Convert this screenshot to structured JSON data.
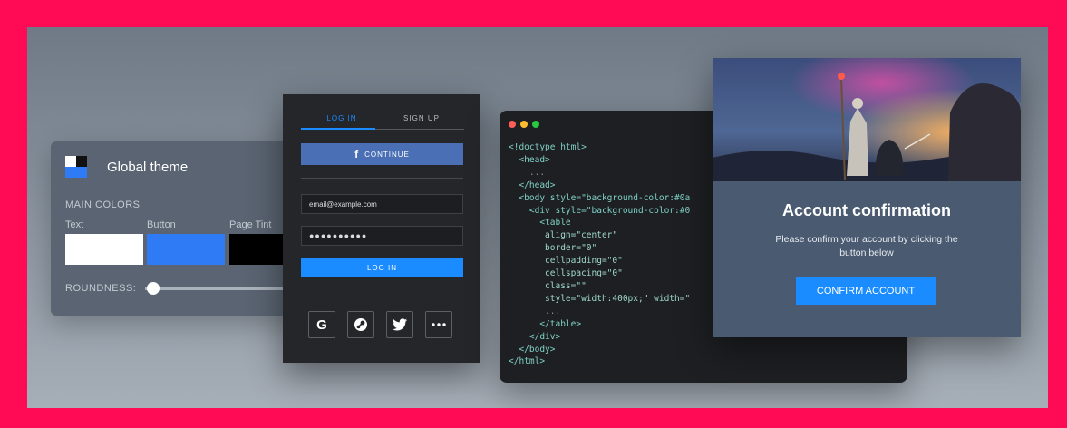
{
  "theme_panel": {
    "title": "Global theme",
    "main_colors_label": "MAIN COLORS",
    "swatches": [
      {
        "label": "Text",
        "color": "#ffffff"
      },
      {
        "label": "Button",
        "color": "#2f7bf5"
      },
      {
        "label": "Page Tint",
        "color": "#000000"
      }
    ],
    "roundness_label": "ROUNDNESS:",
    "logo_icon": "theme-logo-icon"
  },
  "login_panel": {
    "tab_login": "LOG IN",
    "tab_signup": "SIGN UP",
    "facebook_label": "CONTINUE",
    "email_value": "email@example.com",
    "password_value": "●●●●●●●●●●",
    "login_button": "LOG IN",
    "social_icons": [
      "google-icon",
      "steam-icon",
      "twitter-icon",
      "more-icon"
    ],
    "accent": "#1a8cff"
  },
  "code_panel": {
    "lines": [
      "<!doctype html>",
      "  <head>",
      "    ...",
      "  </head>",
      "  <body style=\"background-color:#0a",
      "    <div style=\"background-color:#0",
      "      <table",
      "       align=\"center\"",
      "       border=\"0\"",
      "       cellpadding=\"0\"",
      "       cellspacing=\"0\"",
      "       class=\"\"",
      "       style=\"width:400px;\" width=\"",
      "       ...",
      "      </table>",
      "    </div>",
      "  </body>",
      "</html>"
    ],
    "window_dots": [
      "#ff5f57",
      "#febc2e",
      "#28c840"
    ]
  },
  "email_panel": {
    "title": "Account confirmation",
    "body": "Please confirm your account by clicking the button below",
    "button": "CONFIRM ACCOUNT"
  }
}
